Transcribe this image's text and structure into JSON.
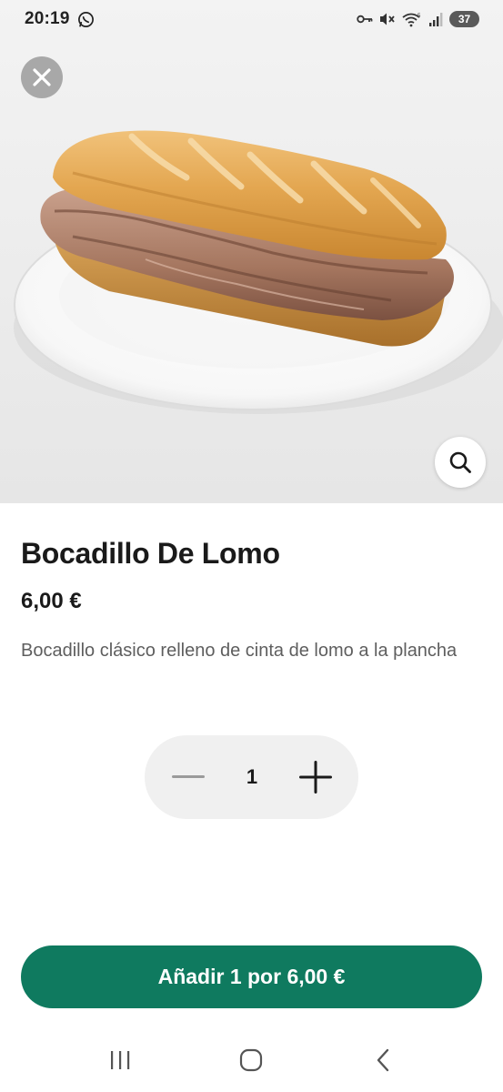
{
  "status_bar": {
    "time": "20:19",
    "battery": "37",
    "icons": [
      "whatsapp-icon",
      "key-icon",
      "mute-icon",
      "wifi-icon",
      "signal-icon",
      "battery-icon"
    ]
  },
  "product": {
    "name": "Bocadillo De Lomo",
    "price": "6,00 €",
    "description": "Bocadillo clásico relleno de cinta de lomo a la plancha",
    "image_icon": "sandwich-photo"
  },
  "stepper": {
    "quantity": "1",
    "decrease_icon": "minus-icon",
    "increase_icon": "plus-icon"
  },
  "actions": {
    "add_label": "Añadir 1 por 6,00 €",
    "close_icon": "close-icon",
    "zoom_icon": "search-icon"
  },
  "nav": {
    "icons": [
      "recent-apps-icon",
      "home-icon",
      "back-icon"
    ]
  },
  "colors": {
    "primary_button": "#0f7a5f",
    "stepper_background": "#f0f0f0",
    "text_primary": "#1a1a1a",
    "text_secondary": "#5e5e5e"
  }
}
